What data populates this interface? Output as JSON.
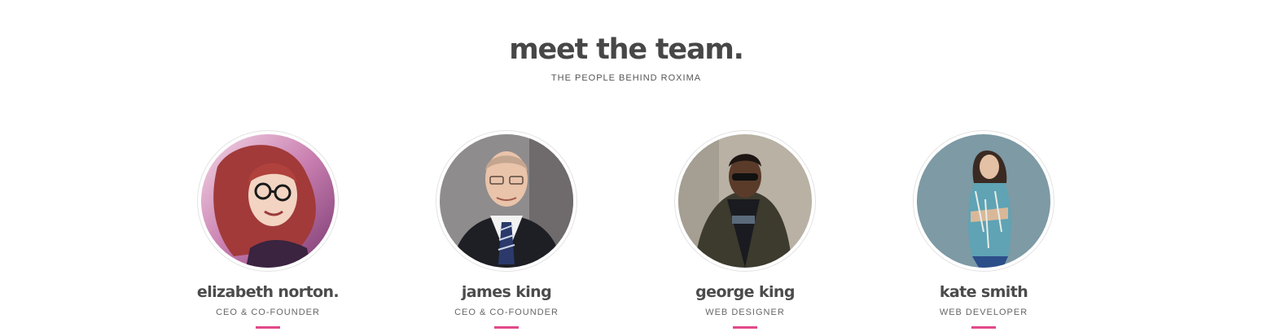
{
  "header": {
    "title": "meet the team.",
    "subtitle": "THE PEOPLE BEHIND ROXIMA"
  },
  "team": [
    {
      "name": "elizabeth norton.",
      "role": "CEO & CO-FOUNDER"
    },
    {
      "name": "james king",
      "role": "CEO & CO-FOUNDER"
    },
    {
      "name": "george king",
      "role": "WEB DESIGNER"
    },
    {
      "name": "kate smith",
      "role": "WEB DEVELOPER"
    }
  ],
  "colors": {
    "accent": "#e2498a",
    "heading": "#474747",
    "text": "#666666"
  }
}
